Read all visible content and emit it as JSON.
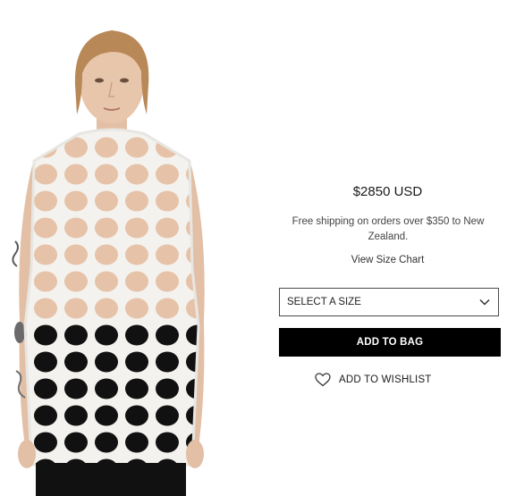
{
  "product": {
    "image_alt": "model wearing white lattice cut-out vest"
  },
  "purchase_panel": {
    "price": "$2850 USD",
    "shipping_note": "Free shipping on orders over $350 to New Zealand.",
    "size_chart_link": "View Size Chart",
    "size_select": {
      "selected": "SELECT A SIZE",
      "icon": "chevron-down-icon"
    },
    "add_to_bag_label": "ADD TO BAG",
    "wishlist": {
      "label": "ADD TO WISHLIST",
      "icon": "heart-icon"
    }
  },
  "colors": {
    "button_bg": "#000000",
    "button_text": "#ffffff",
    "text": "#222222"
  }
}
